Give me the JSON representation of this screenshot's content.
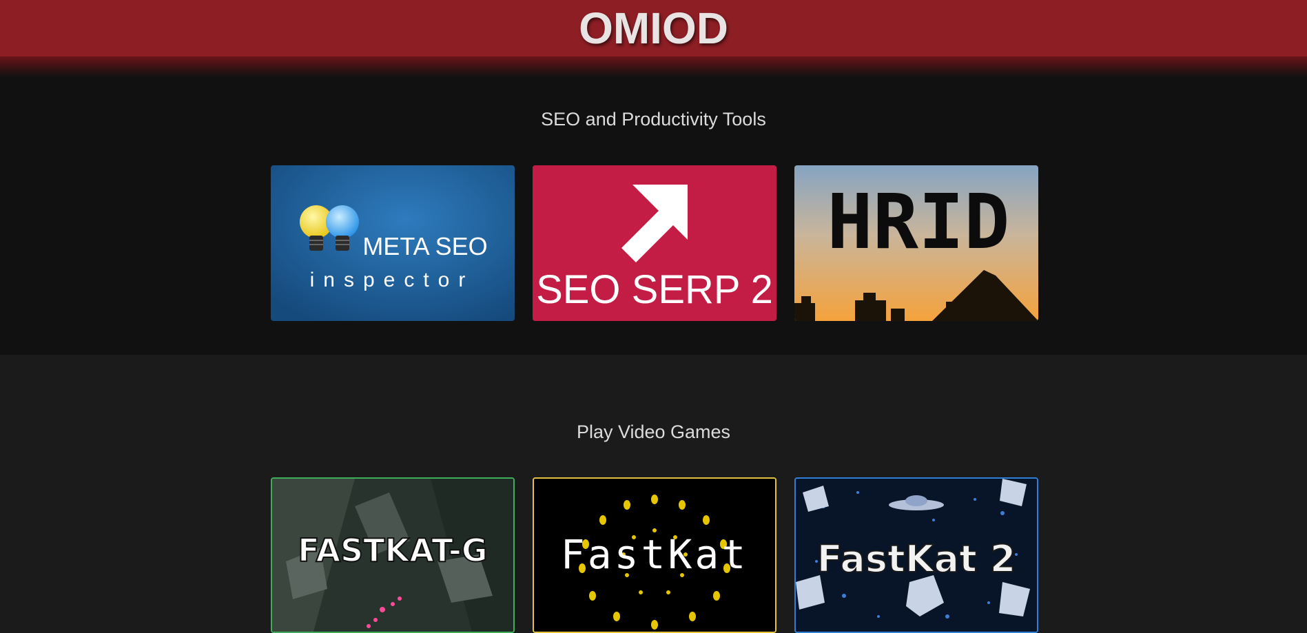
{
  "header": {
    "title": "OMIOD",
    "bg_color": "#8c1e24"
  },
  "sections": [
    {
      "heading": "SEO and Productivity Tools",
      "cards": [
        {
          "title": "META SEO",
          "subtitle": "inspector",
          "icon": "light-bulbs-icon",
          "bg_color": "#1f5b8f"
        },
        {
          "title": "SEO SERP 2",
          "icon": "arrow-up-right-icon",
          "bg_color": "#c41d45"
        },
        {
          "title": "HRID",
          "bg_color": "#e9a04d"
        }
      ]
    },
    {
      "heading": "Play Video Games",
      "cards": [
        {
          "title": "FASTKAT-G",
          "border_color": "#3fae5a"
        },
        {
          "title": "FastKat",
          "border_color": "#e3c241"
        },
        {
          "title": "FastKat 2",
          "border_color": "#2f7fd8"
        }
      ]
    }
  ]
}
